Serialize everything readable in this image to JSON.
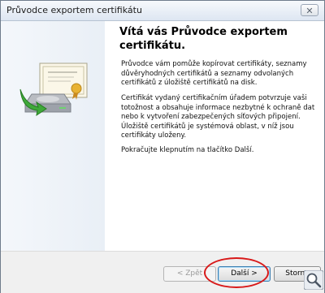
{
  "window": {
    "title": "Průvodce exportem certifikátu",
    "close_label": "✕"
  },
  "main": {
    "heading": "Vítá vás Průvodce exportem certifikátu.",
    "paragraphs": [
      "Průvodce vám pomůže kopírovat certifikáty, seznamy důvěryhodných certifikátů a seznamy odvolaných certifikátů z úložiště certifikátů na disk.",
      "Certifikát vydaný certifikačním úřadem potvrzuje vaši totožnost a obsahuje informace nezbytné k ochraně dat nebo k vytvoření zabezpečených síťových připojení. Úložiště certifikátů je systémová oblast, v níž jsou certifikáty uloženy.",
      "Pokračujte klepnutím na tlačítko Další."
    ]
  },
  "buttons": {
    "back": "< Zpět",
    "next": "Další >",
    "cancel": "Storno"
  },
  "icons": {
    "wizard": "certificate-export-icon",
    "zoom": "magnifier-icon"
  },
  "colors": {
    "highlight": "#d81818"
  }
}
